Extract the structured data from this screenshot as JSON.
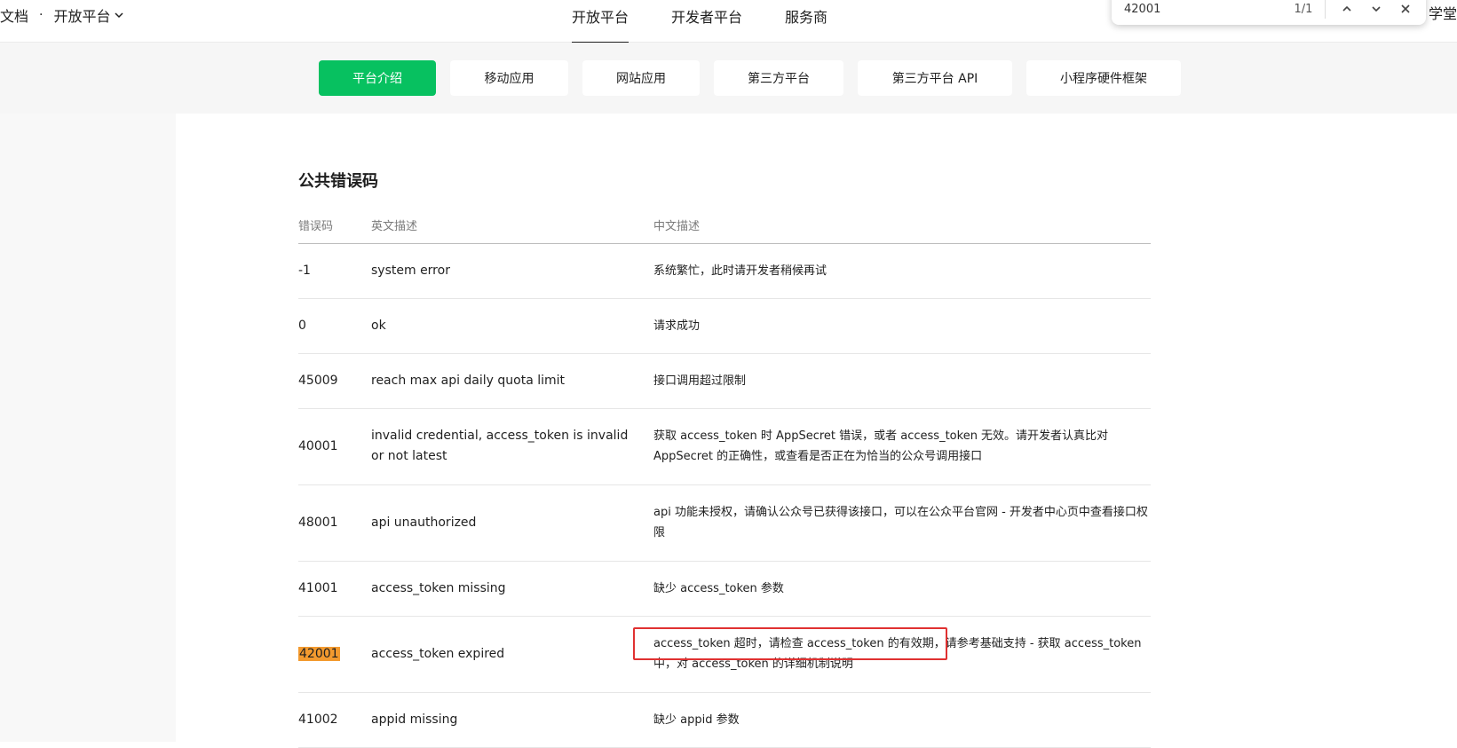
{
  "header": {
    "brand_doc": "文档",
    "brand_sep": "·",
    "brand_platform": "开放平台",
    "nav": [
      {
        "label": "开放平台",
        "active": true
      },
      {
        "label": "开发者平台",
        "active": false
      },
      {
        "label": "服务商",
        "active": false
      }
    ],
    "user_tail": "学堂"
  },
  "find_bar": {
    "query": "42001",
    "count": "1/1"
  },
  "subnav": [
    {
      "label": "平台介绍",
      "active": true
    },
    {
      "label": "移动应用",
      "active": false
    },
    {
      "label": "网站应用",
      "active": false
    },
    {
      "label": "第三方平台",
      "active": false
    },
    {
      "label": "第三方平台 API",
      "active": false
    },
    {
      "label": "小程序硬件框架",
      "active": false
    }
  ],
  "section": {
    "title": "公共错误码",
    "columns": [
      "错误码",
      "英文描述",
      "中文描述"
    ],
    "rows": [
      {
        "code": "-1",
        "en": "system error",
        "zh": "系统繁忙，此时请开发者稍候再试"
      },
      {
        "code": "0",
        "en": "ok",
        "zh": "请求成功"
      },
      {
        "code": "45009",
        "en": "reach max api daily quota limit",
        "zh": "接口调用超过限制"
      },
      {
        "code": "40001",
        "en": "invalid credential, access_token is invalid or not latest",
        "zh": "获取 access_token 时 AppSecret 错误，或者 access_token 无效。请开发者认真比对 AppSecret 的正确性，或查看是否正在为恰当的公众号调用接口"
      },
      {
        "code": "48001",
        "en": "api unauthorized",
        "zh": "api 功能未授权，请确认公众号已获得该接口，可以在公众平台官网 - 开发者中心页中查看接口权限"
      },
      {
        "code": "41001",
        "en": "access_token missing",
        "zh": "缺少 access_token 参数"
      },
      {
        "code": "42001",
        "en": "access_token expired",
        "zh_part1": "access_token 超时，请检查 access_token 的有效期",
        "zh_part2": "，请参考基础支持 - 获取 access_token 中，对 access_token 的详细机制说明"
      },
      {
        "code": "41002",
        "en": "appid missing",
        "zh": "缺少 appid 参数"
      }
    ]
  },
  "colors": {
    "accent": "#07c160",
    "highlight": "#f39a2f",
    "annotation_box": "#e03131"
  }
}
